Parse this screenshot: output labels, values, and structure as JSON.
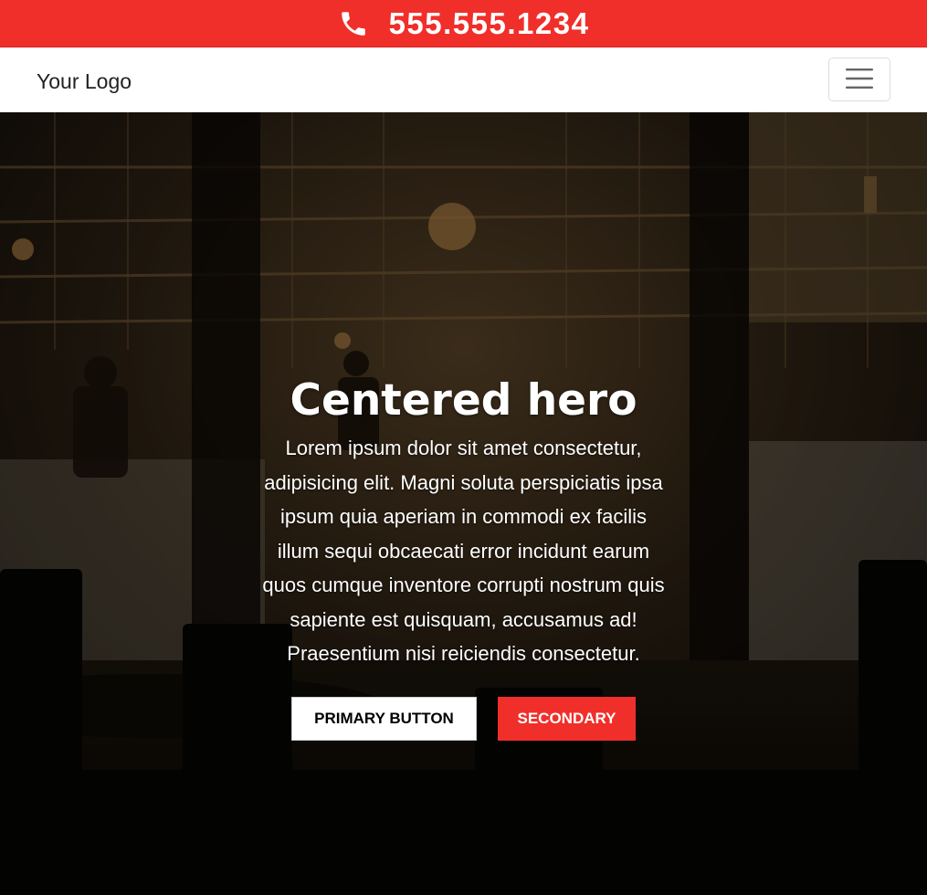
{
  "topbar": {
    "phone_icon": "phone-icon",
    "phone": "555.555.1234",
    "color": "#f02f2a"
  },
  "navbar": {
    "logo": "Your Logo",
    "menu_icon": "hamburger-icon"
  },
  "hero": {
    "title": "Centered hero",
    "text": "Lorem ipsum dolor sit amet consectetur, adipisicing elit. Magni soluta perspiciatis ipsa ipsum quia aperiam in commodi ex facilis illum sequi obcaecati error incidunt earum quos cumque inventore corrupti nostrum quis sapiente est quisquam, accusamus ad! Praesentium nisi reiciendis consectetur.",
    "primary_button": "Primary button",
    "secondary_button": "Secondary"
  }
}
